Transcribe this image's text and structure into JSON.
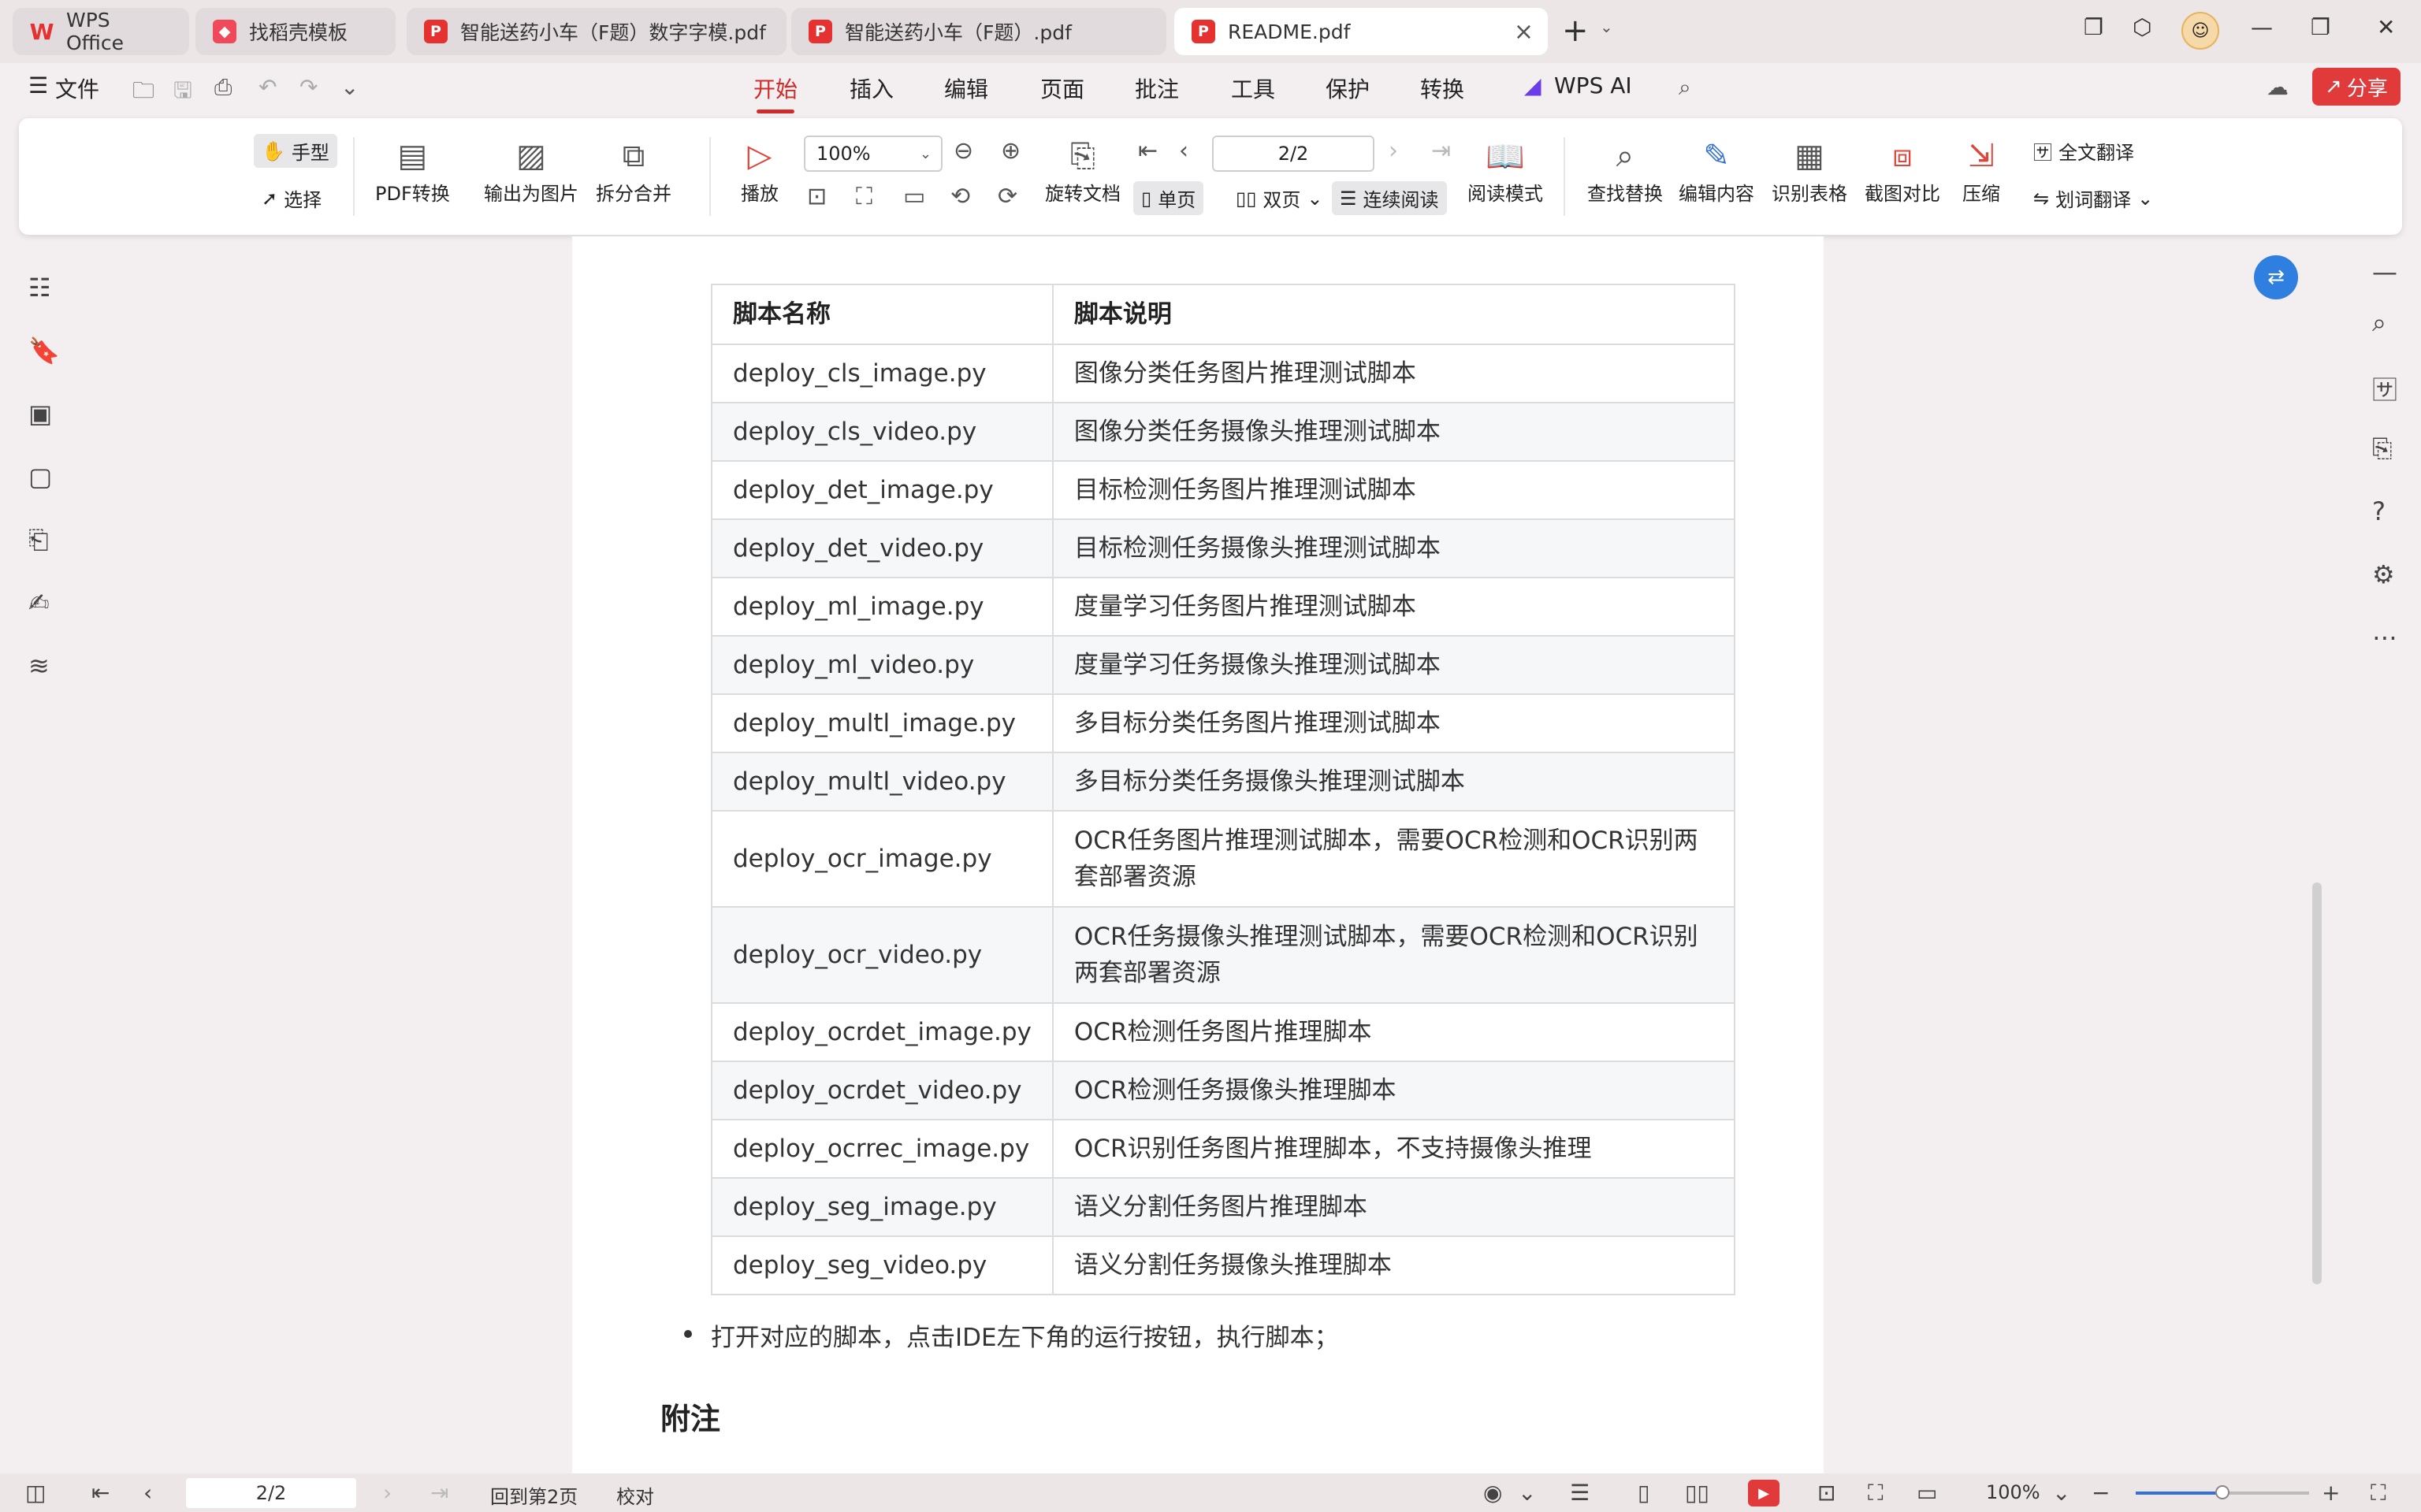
{
  "tabs": [
    {
      "label": "WPS Office",
      "icon": "wps-logo-icon"
    },
    {
      "label": "找稻壳模板",
      "icon": "docer-template-icon"
    },
    {
      "label": "智能送药小车（F题）数字字模.pdf",
      "icon": "pdf-icon"
    },
    {
      "label": "智能送药小车（F题）.pdf",
      "icon": "pdf-icon"
    },
    {
      "label": "README.pdf",
      "icon": "pdf-icon",
      "active": true
    }
  ],
  "menu": {
    "file": "文件",
    "items": [
      "开始",
      "插入",
      "编辑",
      "页面",
      "批注",
      "工具",
      "保护",
      "转换"
    ],
    "active_item": "开始",
    "wps_ai": "WPS AI",
    "share": "分享"
  },
  "ribbon": {
    "hand": "手型",
    "select": "选择",
    "pdf_convert": "PDF转换",
    "export_image": "输出为图片",
    "split_merge": "拆分合并",
    "play": "播放",
    "zoom": "100%",
    "page_input": "2/2",
    "rotate_doc": "旋转文档",
    "single_page": "单页",
    "double_page": "双页",
    "continuous": "连续阅读",
    "read_mode": "阅读模式",
    "find_replace": "查找替换",
    "edit_content": "编辑内容",
    "recognize_table": "识别表格",
    "screenshot_compare": "截图对比",
    "compress": "压缩",
    "full_translate": "全文翻译",
    "word_translate": "划词翻译"
  },
  "doc": {
    "table_headers": [
      "脚本名称",
      "脚本说明"
    ],
    "rows": [
      [
        "deploy_cls_image.py",
        "图像分类任务图片推理测试脚本"
      ],
      [
        "deploy_cls_video.py",
        "图像分类任务摄像头推理测试脚本"
      ],
      [
        "deploy_det_image.py",
        "目标检测任务图片推理测试脚本"
      ],
      [
        "deploy_det_video.py",
        "目标检测任务摄像头推理测试脚本"
      ],
      [
        "deploy_ml_image.py",
        "度量学习任务图片推理测试脚本"
      ],
      [
        "deploy_ml_video.py",
        "度量学习任务摄像头推理测试脚本"
      ],
      [
        "deploy_multl_image.py",
        "多目标分类任务图片推理测试脚本"
      ],
      [
        "deploy_multl_video.py",
        "多目标分类任务摄像头推理测试脚本"
      ],
      [
        "deploy_ocr_image.py",
        "OCR任务图片推理测试脚本，需要OCR检测和OCR识别两套部署资源"
      ],
      [
        "deploy_ocr_video.py",
        "OCR任务摄像头推理测试脚本，需要OCR检测和OCR识别两套部署资源"
      ],
      [
        "deploy_ocrdet_image.py",
        "OCR检测任务图片推理脚本"
      ],
      [
        "deploy_ocrdet_video.py",
        "OCR检测任务摄像头推理脚本"
      ],
      [
        "deploy_ocrrec_image.py",
        "OCR识别任务图片推理脚本，不支持摄像头推理"
      ],
      [
        "deploy_seg_image.py",
        "语义分割任务图片推理脚本"
      ],
      [
        "deploy_seg_video.py",
        "语义分割任务摄像头推理脚本"
      ]
    ],
    "bullet": "打开对应的脚本，点击IDE左下角的运行按钮，执行脚本；",
    "section_title": "附注"
  },
  "status": {
    "page": "2/2",
    "back_to_page": "回到第2页",
    "proofread": "校对",
    "zoom": "100%",
    "zoom_fraction": 0.5
  },
  "colors": {
    "accent": "#d12a2a",
    "share": "#e03a3a",
    "pdf_icon": "#e5312f"
  }
}
